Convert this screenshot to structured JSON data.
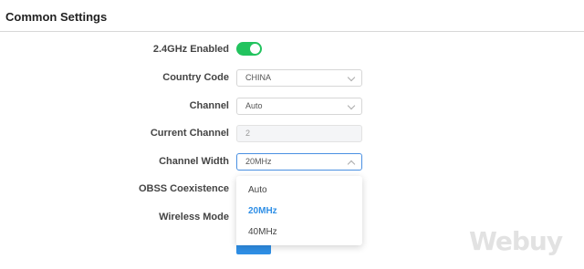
{
  "section": {
    "title": "Common Settings"
  },
  "fields": {
    "enabled": {
      "label": "2.4GHz Enabled",
      "state": "on"
    },
    "country": {
      "label": "Country Code",
      "value": "CHINA"
    },
    "channel": {
      "label": "Channel",
      "value": "Auto"
    },
    "current_channel": {
      "label": "Current Channel",
      "value": "2"
    },
    "channel_width": {
      "label": "Channel Width",
      "value": "20MHz",
      "options": [
        "Auto",
        "20MHz",
        "40MHz"
      ],
      "selected": "20MHz"
    },
    "obss": {
      "label": "OBSS Coexistence"
    },
    "wireless_mode": {
      "label": "Wireless Mode"
    }
  },
  "colors": {
    "toggle_on": "#22c35e",
    "accent": "#2f8fe6"
  },
  "watermark": "Webuy"
}
